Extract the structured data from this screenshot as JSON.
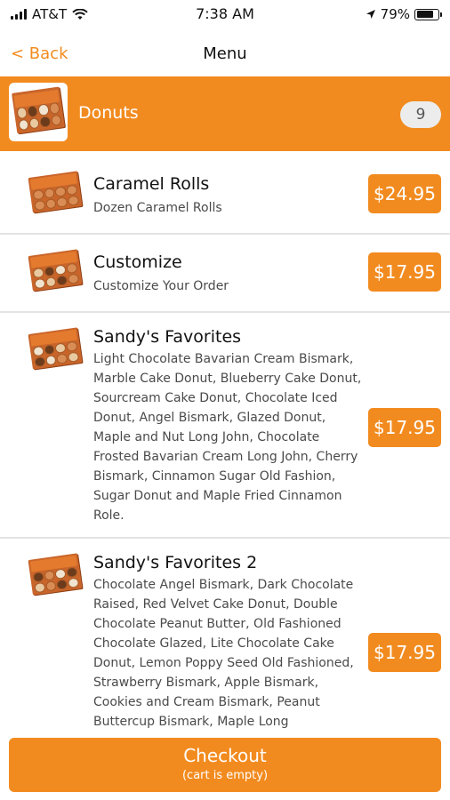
{
  "status_bar": {
    "carrier": "AT&T",
    "time": "7:38 AM",
    "battery": "79%",
    "battery_level": 0.79,
    "icons": [
      "signal-icon",
      "wifi-icon",
      "location-arrow-icon",
      "battery-icon"
    ]
  },
  "nav": {
    "back_label": "< Back",
    "title": "Menu"
  },
  "category": {
    "title": "Donuts",
    "count": "9"
  },
  "items": [
    {
      "name": "Caramel Rolls",
      "description": "Dozen Caramel Rolls",
      "price": "$24.95"
    },
    {
      "name": "Customize",
      "description": "Customize Your Order",
      "price": "$17.95"
    },
    {
      "name": "Sandy's Favorites",
      "description": "Light Chocolate Bavarian Cream Bismark, Marble Cake Donut, Blueberry Cake Donut, Sourcream Cake Donut, Chocolate Iced Donut, Angel Bismark, Glazed Donut, Maple and Nut Long John, Chocolate Frosted Bavarian Cream Long John, Cherry Bismark, Cinnamon Sugar Old Fashion, Sugar Donut and Maple Fried Cinnamon Role.",
      "price": "$17.95"
    },
    {
      "name": "Sandy's Favorites 2",
      "description": "Chocolate Angel Bismark, Dark Chocolate Raised, Red Velvet Cake Donut, Double Chocolate Peanut Butter, Old Fashioned Chocolate Glazed, Lite Chocolate Cake Donut, Lemon Poppy Seed Old Fashioned, Strawberry Bismark, Apple Bismark, Cookies and Cream Bismark, Peanut Buttercup Bismark, Maple Long",
      "price": "$17.95"
    }
  ],
  "checkout": {
    "label": "Checkout",
    "sublabel": "(cart is empty)"
  },
  "colors": {
    "accent": "#f28b1f",
    "badge_bg": "#ececec",
    "divider": "#e3e3e3"
  }
}
